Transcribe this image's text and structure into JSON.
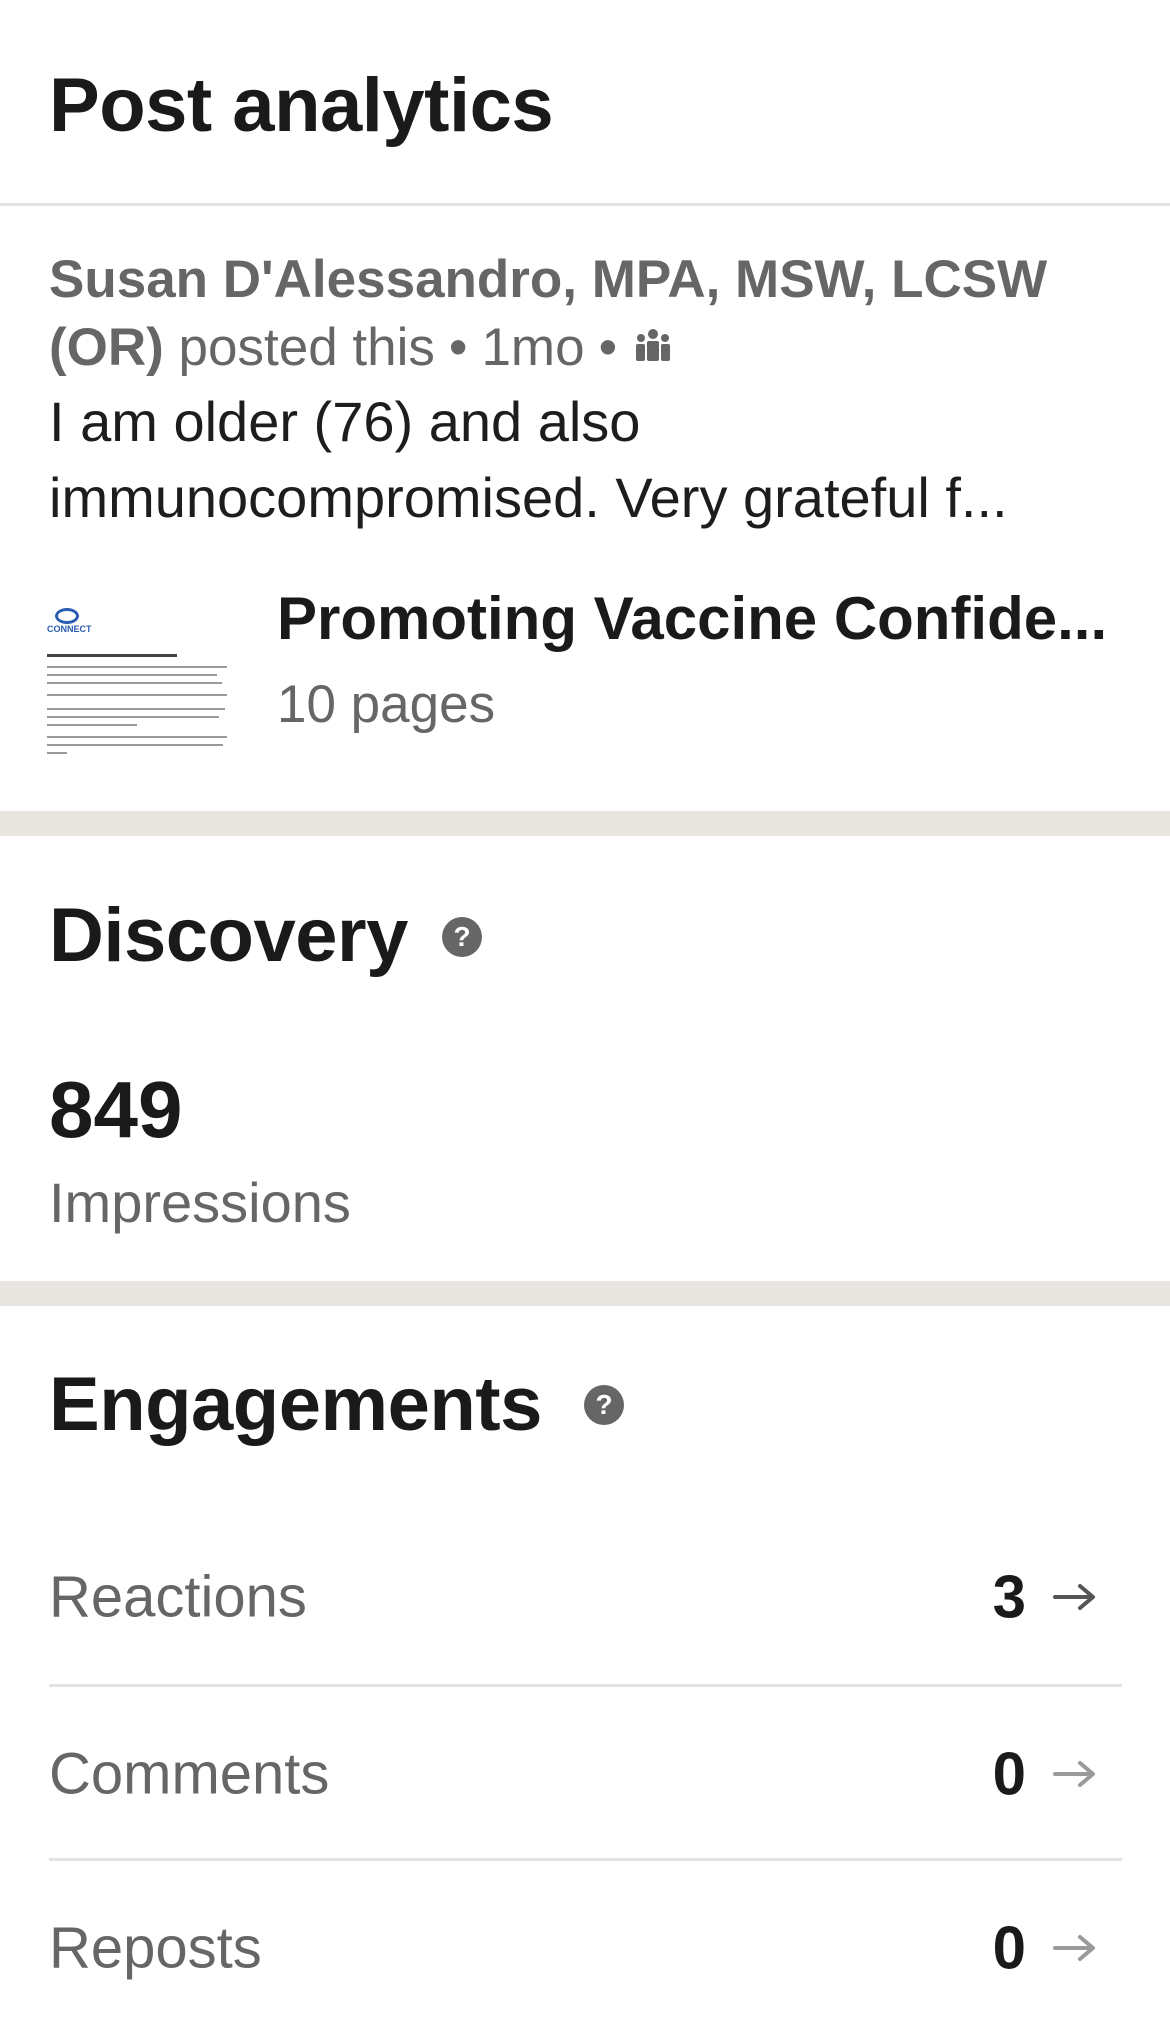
{
  "header": {
    "title": "Post analytics"
  },
  "post": {
    "author": "Susan D'Alessandro, MPA, MSW, LCSW (OR)",
    "action": "posted this",
    "age": "1mo",
    "text_line1": "I am older (76) and also",
    "text_line2": "immunocompromised. Very grateful f...",
    "audience_icon": "group-icon"
  },
  "document": {
    "title": "Promoting Vaccine Confide...",
    "pages": "10 pages",
    "thumb_logo": "CONNECT"
  },
  "discovery": {
    "title": "Discovery",
    "help_icon": "?",
    "impressions_value": "849",
    "impressions_label": "Impressions"
  },
  "engagements": {
    "title": "Engagements",
    "help_icon": "?",
    "rows": [
      {
        "label": "Reactions",
        "value": "3",
        "arrow_color": "#555555"
      },
      {
        "label": "Comments",
        "value": "0",
        "arrow_color": "#9a9a9a"
      },
      {
        "label": "Reposts",
        "value": "0",
        "arrow_color": "#9a9a9a"
      }
    ]
  },
  "colors": {
    "text_primary": "#1a1a1a",
    "text_secondary": "#666666",
    "separator_band": "#e9e6e1",
    "divider": "#e3e3e3"
  }
}
